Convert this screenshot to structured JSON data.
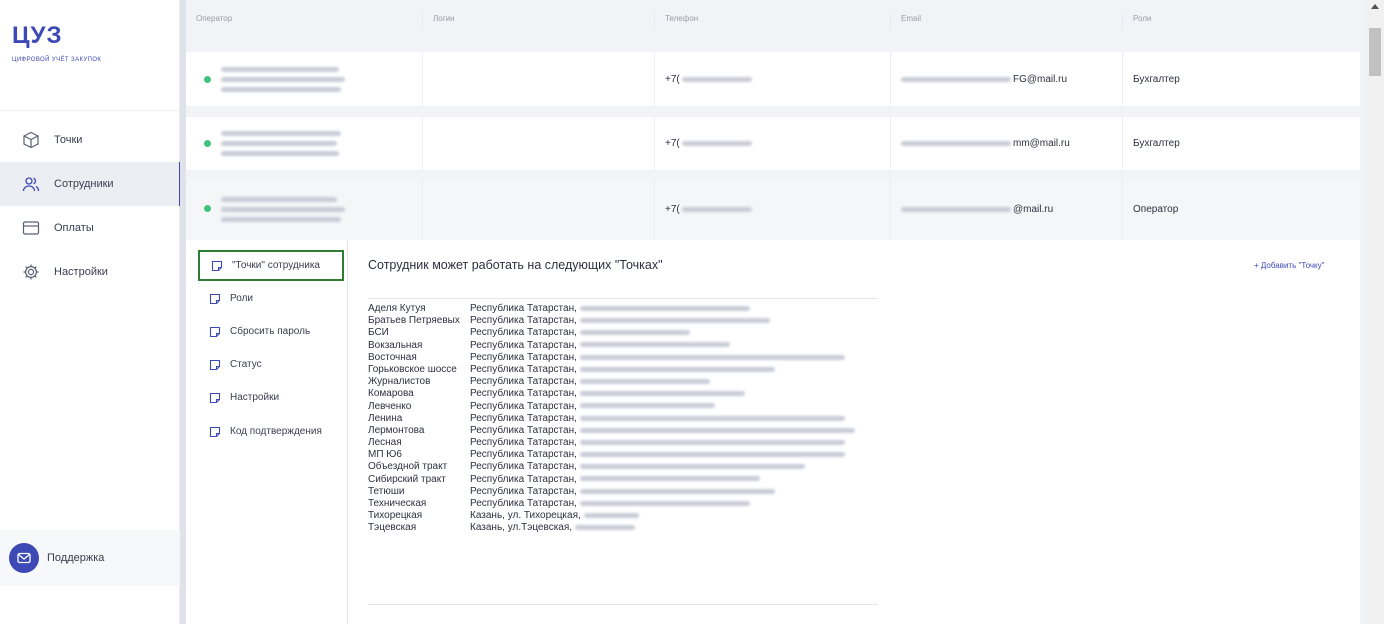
{
  "brand": {
    "title": "ЦУЗ",
    "subtitle": "ЦИФРОВОЙ УЧЁТ ЗАКУПОК"
  },
  "nav": [
    {
      "label": "Точки",
      "icon": "cube-icon",
      "active": false
    },
    {
      "label": "Сотрудники",
      "icon": "users-icon",
      "active": true
    },
    {
      "label": "Оплаты",
      "icon": "card-icon",
      "active": false
    },
    {
      "label": "Настройки",
      "icon": "gear-icon",
      "active": false
    }
  ],
  "support": {
    "label": "Поддержка",
    "icon": "mail-icon"
  },
  "table": {
    "columns": [
      "Оператор",
      "Логин",
      "Телефон",
      "Email",
      "Роли"
    ],
    "rows": [
      {
        "phone": "+7(",
        "email": "FG@mail.ru",
        "role": "Бухгалтер",
        "status": "online"
      },
      {
        "phone": "+7(",
        "email": "mm@mail.ru",
        "role": "Бухгалтер",
        "status": "online"
      },
      {
        "phone": "+7(",
        "email": "@mail.ru",
        "role": "Оператор",
        "status": "online"
      }
    ]
  },
  "detail": {
    "tabs": [
      {
        "label": "\"Точки\" сотрудника",
        "active": true
      },
      {
        "label": "Роли",
        "active": false
      },
      {
        "label": "Сбросить пароль",
        "active": false
      },
      {
        "label": "Статус",
        "active": false
      },
      {
        "label": "Настройки",
        "active": false
      },
      {
        "label": "Код подтверждения",
        "active": false
      }
    ],
    "title": "Сотрудник может работать на следующих \"Точках\"",
    "add_label": "+   Добавить \"Точку\"",
    "points": [
      {
        "name": "Аделя Кутуя",
        "addr": "Республика Татарстан,",
        "blur": 170
      },
      {
        "name": "Братьев Петряевых",
        "addr": "Республика Татарстан,",
        "blur": 190
      },
      {
        "name": "БСИ",
        "addr": "Республика Татарстан,",
        "blur": 110
      },
      {
        "name": "Вокзальная",
        "addr": "Республика Татарстан,",
        "blur": 150
      },
      {
        "name": "Восточная",
        "addr": "Республика Татарстан,",
        "blur": 265
      },
      {
        "name": "Горьковское шоссе",
        "addr": "Республика Татарстан,",
        "blur": 195
      },
      {
        "name": "Журналистов",
        "addr": "Республика Татарстан,",
        "blur": 130
      },
      {
        "name": "Комарова",
        "addr": "Республика Татарстан,",
        "blur": 165
      },
      {
        "name": "Левченко",
        "addr": "Республика Татарстан,",
        "blur": 135
      },
      {
        "name": "Ленина",
        "addr": "Республика Татарстан,",
        "blur": 265
      },
      {
        "name": "Лермонтова",
        "addr": "Республика Татарстан,",
        "blur": 275
      },
      {
        "name": "Лесная",
        "addr": "Республика Татарстан,",
        "blur": 265
      },
      {
        "name": "МП Ю6",
        "addr": "Республика Татарстан,",
        "blur": 265
      },
      {
        "name": "Объездной тракт",
        "addr": "Республика Татарстан,",
        "blur": 225
      },
      {
        "name": "Сибирский тракт",
        "addr": "Республика Татарстан,",
        "blur": 180
      },
      {
        "name": "Тетюши",
        "addr": "Республика Татарстан,",
        "blur": 195
      },
      {
        "name": "Техническая",
        "addr": "Республика Татарстан,",
        "blur": 170
      },
      {
        "name": "Тихорецкая",
        "addr": "Казань, ул. Тихорецкая,",
        "blur": 55
      },
      {
        "name": "Тэцевская",
        "addr": "Казань, ул.Тэцевская,",
        "blur": 60
      }
    ]
  },
  "colors": {
    "accent": "#3d4ab5",
    "online": "#3ec37c",
    "active_tab_border": "#2e7d32"
  }
}
